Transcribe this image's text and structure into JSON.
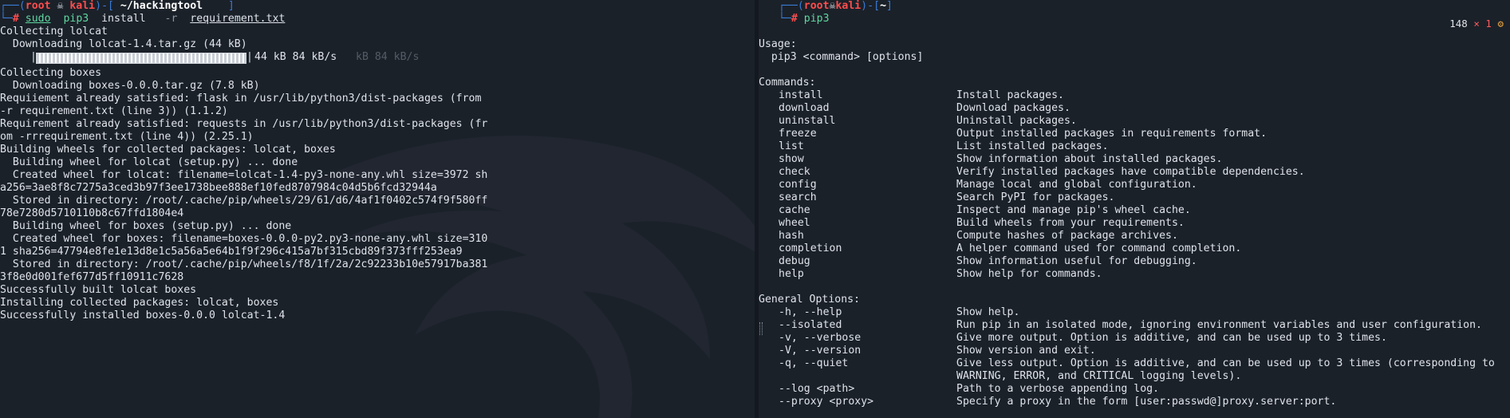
{
  "left": {
    "prompt": {
      "user": "root",
      "host": "kali",
      "dir": "~/hackingtool",
      "cmd_sudo": "sudo",
      "cmd_pip3": "pip3",
      "cmd_install": "install",
      "cmd_flag": "-r",
      "cmd_file": "requirement.txt"
    },
    "lines_top": [
      "Collecting lolcat",
      "  Downloading lolcat-1.4.tar.gz (44 kB)"
    ],
    "progress": {
      "fraction": 1.0,
      "text": "44 kB 84 kB/s",
      "ghost": "kB 84 kB/s"
    },
    "lines_bottom": [
      "Collecting boxes",
      "  Downloading boxes-0.0.0.tar.gz (7.8 kB)",
      "Requiiement already satisfied: flask in /usr/lib/python3/dist-packages (from",
      "-r requirement.txt (line 3)) (1.1.2)",
      "Requirement already satisfied: requests in /usr/lib/python3/dist-packages (fr",
      "om -rrrequirement.txt (line 4)) (2.25.1)",
      "Building wheels for collected packages: lolcat, boxes",
      "  Building wheel for lolcat (setup.py) ... done",
      "  Created wheel for lolcat: filename=lolcat-1.4-py3-none-any.whl size=3972 sh",
      "a256=3ae8f8c7275a3ced3b97f3ee1738bee888ef10fed8707984c04d5b6fcd32944a",
      "  Stored in directory: /root/.cache/pip/wheels/29/61/d6/4af1f0402c574f9f580ff",
      "78e7280d5710110b8c67ffd1804e4",
      "  Building wheel for boxes (setup.py) ... done",
      "  Created wheel for boxes: filename=boxes-0.0.0-py2.py3-none-any.whl size=310",
      "1 sha256=47794e8fe1e13d8e1c5a56a5e64b1f9f296c415a7bf315cbd89f373fff253ea9",
      "  Stored in directory: /root/.cache/pip/wheels/f8/1f/2a/2c92233b10e57917ba381",
      "3f8e0d001fef677d5ff10911c7628",
      "Successfully built lolcat boxes",
      "Installing collected packages: lolcat, boxes",
      "Successfully installed boxes-0.0.0 lolcat-1.4"
    ]
  },
  "right": {
    "prompt": {
      "user": "root",
      "host": "kali",
      "dir": "~",
      "cmd": "pip3"
    },
    "status": {
      "count": "148",
      "x": "×",
      "code": "1",
      "gear": "⚙"
    },
    "usage_header": "Usage:",
    "usage_line": "  pip3 <command> [options]",
    "commands_header": "Commands:",
    "commands": [
      {
        "name": "install",
        "desc": "Install packages."
      },
      {
        "name": "download",
        "desc": "Download packages."
      },
      {
        "name": "uninstall",
        "desc": "Uninstall packages."
      },
      {
        "name": "freeze",
        "desc": "Output installed packages in requirements format."
      },
      {
        "name": "list",
        "desc": "List installed packages."
      },
      {
        "name": "show",
        "desc": "Show information about installed packages."
      },
      {
        "name": "check",
        "desc": "Verify installed packages have compatible dependencies."
      },
      {
        "name": "config",
        "desc": "Manage local and global configuration."
      },
      {
        "name": "search",
        "desc": "Search PyPI for packages."
      },
      {
        "name": "cache",
        "desc": "Inspect and manage pip's wheel cache."
      },
      {
        "name": "wheel",
        "desc": "Build wheels from your requirements."
      },
      {
        "name": "hash",
        "desc": "Compute hashes of package archives."
      },
      {
        "name": "completion",
        "desc": "A helper command used for command completion."
      },
      {
        "name": "debug",
        "desc": "Show information useful for debugging."
      },
      {
        "name": "help",
        "desc": "Show help for commands."
      }
    ],
    "options_header": "General Options:",
    "options": [
      {
        "name": "-h, --help",
        "desc": "Show help."
      },
      {
        "name": "--isolated",
        "desc": "Run pip in an isolated mode, ignoring environment variables and user configuration."
      },
      {
        "name": "-v, --verbose",
        "desc": "Give more output. Option is additive, and can be used up to 3 times."
      },
      {
        "name": "-V, --version",
        "desc": "Show version and exit."
      },
      {
        "name": "-q, --quiet",
        "desc": "Give less output. Option is additive, and can be used up to 3 times (corresponding to\nWARNING, ERROR, and CRITICAL logging levels)."
      },
      {
        "name": "--log <path>",
        "desc": "Path to a verbose appending log."
      },
      {
        "name": "--proxy <proxy>",
        "desc": "Specify a proxy in the form [user:passwd@]proxy.server:port."
      }
    ]
  },
  "colors": {
    "background": "#1b2129",
    "prompt_frame": "#3a7bd5",
    "prompt_user": "#ff4d4d",
    "command": "#5fd7a0"
  },
  "icons": [
    "skull-icon",
    "close-x-icon",
    "gear-icon"
  ]
}
